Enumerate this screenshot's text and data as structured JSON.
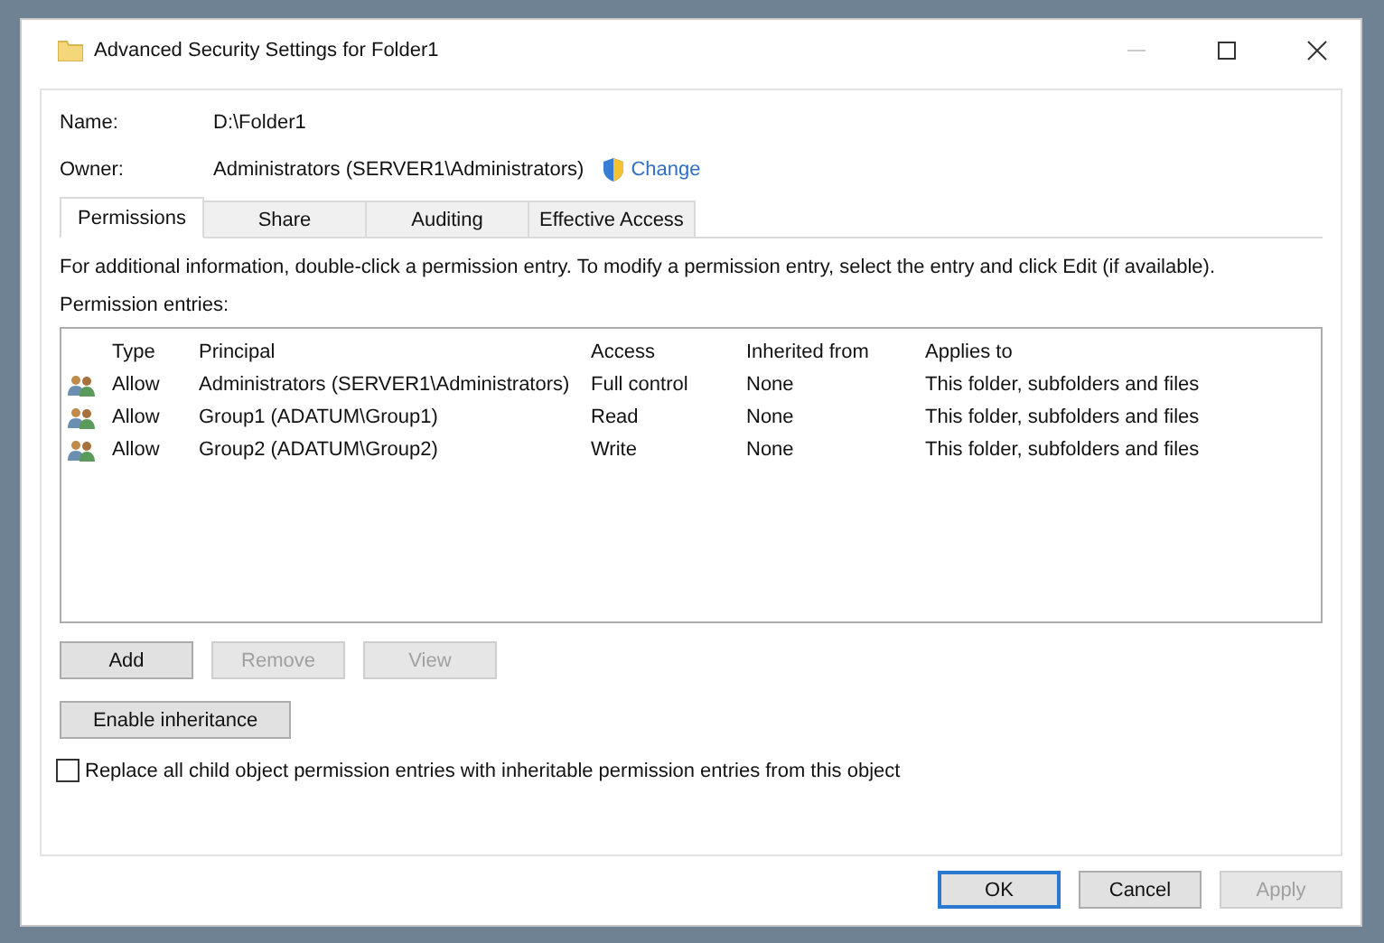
{
  "window": {
    "title": "Advanced Security Settings for Folder1"
  },
  "fields": [
    {
      "label": "Name:",
      "value": "D:\\Folder1"
    },
    {
      "label": "Owner:",
      "value": "Administrators (SERVER1\\Administrators)",
      "link": "Change"
    }
  ],
  "tabs": [
    {
      "label": "Permissions",
      "selected": true
    },
    {
      "label": "Share",
      "selected": false
    },
    {
      "label": "Auditing",
      "selected": false
    },
    {
      "label": "Effective Access",
      "selected": false
    }
  ],
  "info": "For additional information, double-click a permission entry. To modify a permission entry, select the entry and click Edit (if available).",
  "entries_label": "Permission entries:",
  "table": {
    "columns": [
      "Type",
      "Principal",
      "Access",
      "Inherited from",
      "Applies to"
    ],
    "rows": [
      [
        "Allow",
        "Administrators (SERVER1\\Administrators)",
        "Full control",
        "None",
        "This folder, subfolders and files"
      ],
      [
        "Allow",
        "Group1 (ADATUM\\Group1)",
        "Read",
        "None",
        "This folder, subfolders and files"
      ],
      [
        "Allow",
        "Group2 (ADATUM\\Group2)",
        "Write",
        "None",
        "This folder, subfolders and files"
      ]
    ]
  },
  "entry_buttons": [
    {
      "label": "Add",
      "disabled": false
    },
    {
      "label": "Remove",
      "disabled": true
    },
    {
      "label": "View",
      "disabled": true
    }
  ],
  "inheritance_button": "Enable inheritance",
  "replace_checkbox": {
    "label": "Replace all child object permission entries with inheritable permission entries from this object",
    "checked": false
  },
  "dialog_buttons": [
    {
      "label": "OK",
      "disabled": false,
      "default": true
    },
    {
      "label": "Cancel",
      "disabled": false,
      "default": false
    },
    {
      "label": "Apply",
      "disabled": true,
      "default": false
    }
  ]
}
